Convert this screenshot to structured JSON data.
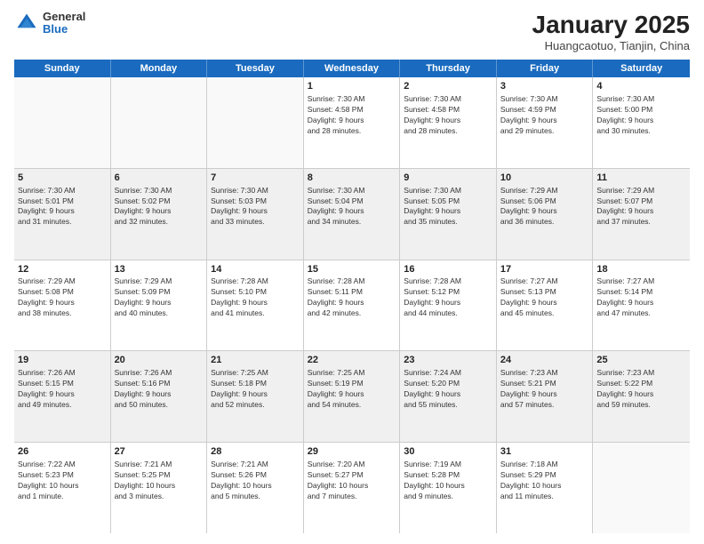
{
  "header": {
    "logo_general": "General",
    "logo_blue": "Blue",
    "title": "January 2025",
    "subtitle": "Huangcaotuo, Tianjin, China"
  },
  "days_of_week": [
    "Sunday",
    "Monday",
    "Tuesday",
    "Wednesday",
    "Thursday",
    "Friday",
    "Saturday"
  ],
  "weeks": [
    [
      {
        "num": "",
        "lines": [],
        "empty": true
      },
      {
        "num": "",
        "lines": [],
        "empty": true
      },
      {
        "num": "",
        "lines": [],
        "empty": true
      },
      {
        "num": "1",
        "lines": [
          "Sunrise: 7:30 AM",
          "Sunset: 4:58 PM",
          "Daylight: 9 hours",
          "and 28 minutes."
        ]
      },
      {
        "num": "2",
        "lines": [
          "Sunrise: 7:30 AM",
          "Sunset: 4:58 PM",
          "Daylight: 9 hours",
          "and 28 minutes."
        ]
      },
      {
        "num": "3",
        "lines": [
          "Sunrise: 7:30 AM",
          "Sunset: 4:59 PM",
          "Daylight: 9 hours",
          "and 29 minutes."
        ]
      },
      {
        "num": "4",
        "lines": [
          "Sunrise: 7:30 AM",
          "Sunset: 5:00 PM",
          "Daylight: 9 hours",
          "and 30 minutes."
        ]
      }
    ],
    [
      {
        "num": "5",
        "lines": [
          "Sunrise: 7:30 AM",
          "Sunset: 5:01 PM",
          "Daylight: 9 hours",
          "and 31 minutes."
        ],
        "shaded": true
      },
      {
        "num": "6",
        "lines": [
          "Sunrise: 7:30 AM",
          "Sunset: 5:02 PM",
          "Daylight: 9 hours",
          "and 32 minutes."
        ],
        "shaded": true
      },
      {
        "num": "7",
        "lines": [
          "Sunrise: 7:30 AM",
          "Sunset: 5:03 PM",
          "Daylight: 9 hours",
          "and 33 minutes."
        ],
        "shaded": true
      },
      {
        "num": "8",
        "lines": [
          "Sunrise: 7:30 AM",
          "Sunset: 5:04 PM",
          "Daylight: 9 hours",
          "and 34 minutes."
        ],
        "shaded": true
      },
      {
        "num": "9",
        "lines": [
          "Sunrise: 7:30 AM",
          "Sunset: 5:05 PM",
          "Daylight: 9 hours",
          "and 35 minutes."
        ],
        "shaded": true
      },
      {
        "num": "10",
        "lines": [
          "Sunrise: 7:29 AM",
          "Sunset: 5:06 PM",
          "Daylight: 9 hours",
          "and 36 minutes."
        ],
        "shaded": true
      },
      {
        "num": "11",
        "lines": [
          "Sunrise: 7:29 AM",
          "Sunset: 5:07 PM",
          "Daylight: 9 hours",
          "and 37 minutes."
        ],
        "shaded": true
      }
    ],
    [
      {
        "num": "12",
        "lines": [
          "Sunrise: 7:29 AM",
          "Sunset: 5:08 PM",
          "Daylight: 9 hours",
          "and 38 minutes."
        ]
      },
      {
        "num": "13",
        "lines": [
          "Sunrise: 7:29 AM",
          "Sunset: 5:09 PM",
          "Daylight: 9 hours",
          "and 40 minutes."
        ]
      },
      {
        "num": "14",
        "lines": [
          "Sunrise: 7:28 AM",
          "Sunset: 5:10 PM",
          "Daylight: 9 hours",
          "and 41 minutes."
        ]
      },
      {
        "num": "15",
        "lines": [
          "Sunrise: 7:28 AM",
          "Sunset: 5:11 PM",
          "Daylight: 9 hours",
          "and 42 minutes."
        ]
      },
      {
        "num": "16",
        "lines": [
          "Sunrise: 7:28 AM",
          "Sunset: 5:12 PM",
          "Daylight: 9 hours",
          "and 44 minutes."
        ]
      },
      {
        "num": "17",
        "lines": [
          "Sunrise: 7:27 AM",
          "Sunset: 5:13 PM",
          "Daylight: 9 hours",
          "and 45 minutes."
        ]
      },
      {
        "num": "18",
        "lines": [
          "Sunrise: 7:27 AM",
          "Sunset: 5:14 PM",
          "Daylight: 9 hours",
          "and 47 minutes."
        ]
      }
    ],
    [
      {
        "num": "19",
        "lines": [
          "Sunrise: 7:26 AM",
          "Sunset: 5:15 PM",
          "Daylight: 9 hours",
          "and 49 minutes."
        ],
        "shaded": true
      },
      {
        "num": "20",
        "lines": [
          "Sunrise: 7:26 AM",
          "Sunset: 5:16 PM",
          "Daylight: 9 hours",
          "and 50 minutes."
        ],
        "shaded": true
      },
      {
        "num": "21",
        "lines": [
          "Sunrise: 7:25 AM",
          "Sunset: 5:18 PM",
          "Daylight: 9 hours",
          "and 52 minutes."
        ],
        "shaded": true
      },
      {
        "num": "22",
        "lines": [
          "Sunrise: 7:25 AM",
          "Sunset: 5:19 PM",
          "Daylight: 9 hours",
          "and 54 minutes."
        ],
        "shaded": true
      },
      {
        "num": "23",
        "lines": [
          "Sunrise: 7:24 AM",
          "Sunset: 5:20 PM",
          "Daylight: 9 hours",
          "and 55 minutes."
        ],
        "shaded": true
      },
      {
        "num": "24",
        "lines": [
          "Sunrise: 7:23 AM",
          "Sunset: 5:21 PM",
          "Daylight: 9 hours",
          "and 57 minutes."
        ],
        "shaded": true
      },
      {
        "num": "25",
        "lines": [
          "Sunrise: 7:23 AM",
          "Sunset: 5:22 PM",
          "Daylight: 9 hours",
          "and 59 minutes."
        ],
        "shaded": true
      }
    ],
    [
      {
        "num": "26",
        "lines": [
          "Sunrise: 7:22 AM",
          "Sunset: 5:23 PM",
          "Daylight: 10 hours",
          "and 1 minute."
        ]
      },
      {
        "num": "27",
        "lines": [
          "Sunrise: 7:21 AM",
          "Sunset: 5:25 PM",
          "Daylight: 10 hours",
          "and 3 minutes."
        ]
      },
      {
        "num": "28",
        "lines": [
          "Sunrise: 7:21 AM",
          "Sunset: 5:26 PM",
          "Daylight: 10 hours",
          "and 5 minutes."
        ]
      },
      {
        "num": "29",
        "lines": [
          "Sunrise: 7:20 AM",
          "Sunset: 5:27 PM",
          "Daylight: 10 hours",
          "and 7 minutes."
        ]
      },
      {
        "num": "30",
        "lines": [
          "Sunrise: 7:19 AM",
          "Sunset: 5:28 PM",
          "Daylight: 10 hours",
          "and 9 minutes."
        ]
      },
      {
        "num": "31",
        "lines": [
          "Sunrise: 7:18 AM",
          "Sunset: 5:29 PM",
          "Daylight: 10 hours",
          "and 11 minutes."
        ]
      },
      {
        "num": "",
        "lines": [],
        "empty": true
      }
    ]
  ]
}
